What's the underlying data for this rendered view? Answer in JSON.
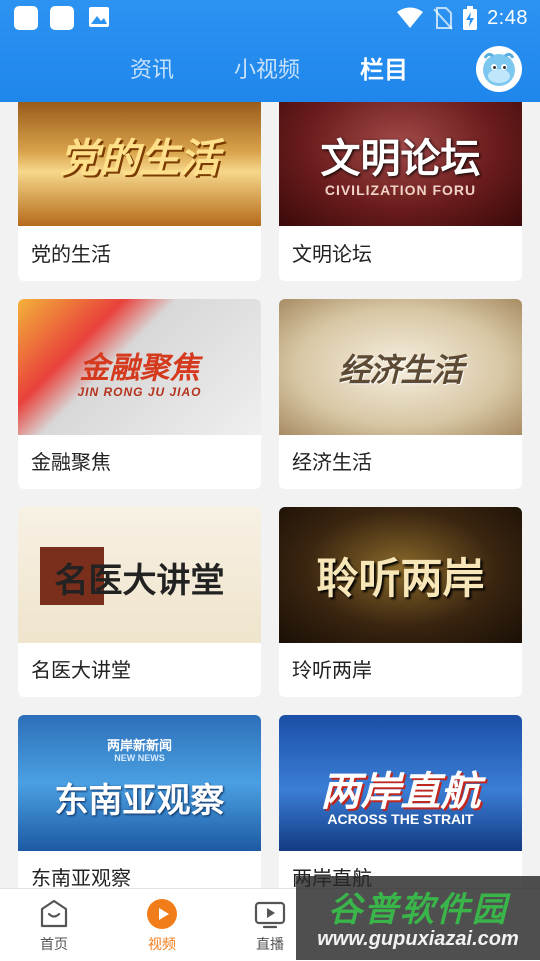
{
  "status_bar": {
    "time": "2:48",
    "icons": [
      "app-square-icon",
      "app-square-icon",
      "image-icon",
      "wifi-icon",
      "no-sim-icon",
      "battery-charging-icon"
    ]
  },
  "tabs": [
    {
      "label": "资讯",
      "active": false
    },
    {
      "label": "小视频",
      "active": false
    },
    {
      "label": "栏目",
      "active": true
    }
  ],
  "columns": [
    {
      "label": "党的生活",
      "thumb_title": "党的生活",
      "thumb_sub": ""
    },
    {
      "label": "文明论坛",
      "thumb_title": "文明论坛",
      "thumb_sub": "CIVILIZATION FORU"
    },
    {
      "label": "金融聚焦",
      "thumb_title": "金融聚焦",
      "thumb_sub": "JIN RONG JU JIAO"
    },
    {
      "label": "经济生活",
      "thumb_title": "经济生活",
      "thumb_sub": ""
    },
    {
      "label": "名医大讲堂",
      "thumb_title": "名医大讲堂",
      "thumb_sub": ""
    },
    {
      "label": "玲听两岸",
      "thumb_title": "聆听两岸",
      "thumb_sub": ""
    },
    {
      "label": "东南亚观察",
      "thumb_title": "东南亚观察",
      "thumb_sub": "两岸新新闻",
      "thumb_sub2": "NEW NEWS"
    },
    {
      "label": "两岸直航",
      "thumb_title": "两岸直航",
      "thumb_sub": "ACROSS THE STRAIT"
    }
  ],
  "bottom_nav": [
    {
      "label": "首页",
      "icon": "home-icon",
      "active": false
    },
    {
      "label": "视频",
      "icon": "play-circle-icon",
      "active": true
    },
    {
      "label": "直播",
      "icon": "tv-play-icon",
      "active": false
    }
  ],
  "watermark": {
    "title": "谷普软件园",
    "url": "www.gupuxiazai.com"
  },
  "colors": {
    "header": "#1f86ec",
    "active_nav": "#f07c1a"
  }
}
